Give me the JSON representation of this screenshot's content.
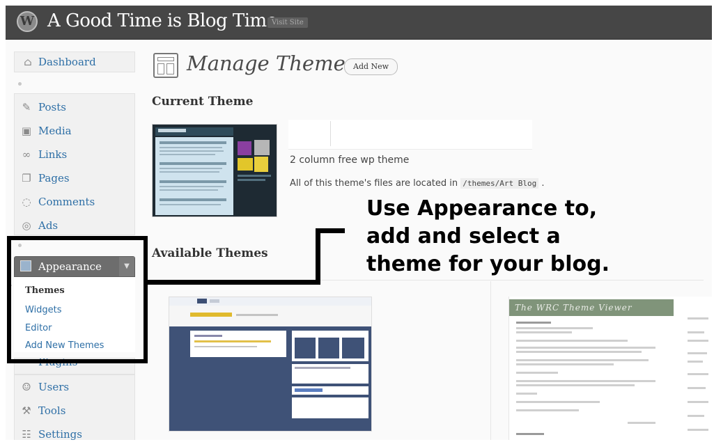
{
  "header": {
    "site_title": "A Good Time is Blog Time",
    "visit_site": "Visit Site"
  },
  "sidebar": {
    "dashboard": "Dashboard",
    "items": [
      "Posts",
      "Media",
      "Links",
      "Pages",
      "Comments",
      "Ads"
    ],
    "appearance": "Appearance",
    "submenu": [
      "Themes",
      "Widgets",
      "Editor",
      "Add New Themes"
    ],
    "partial": "Plugins",
    "lower_items": [
      "Users",
      "Tools",
      "Settings"
    ]
  },
  "main": {
    "title": "Manage Themes",
    "add_new": "Add New",
    "current_theme_heading": "Current Theme",
    "theme_description": "2 column free wp theme",
    "files_prefix": "All of this theme's files are located in",
    "files_path": "/themes/Art Blog",
    "files_suffix": ".",
    "available_heading": "Available Themes",
    "viewer_title": "The WRC Theme Viewer"
  },
  "annotation": {
    "lines": [
      "Use Appearance to,",
      "add and select a",
      "theme for your blog."
    ]
  },
  "colors": {
    "header_bg": "#464646",
    "link": "#2e6fa6",
    "appearance_bg": "#6d6d6d",
    "callout": "#000000"
  }
}
